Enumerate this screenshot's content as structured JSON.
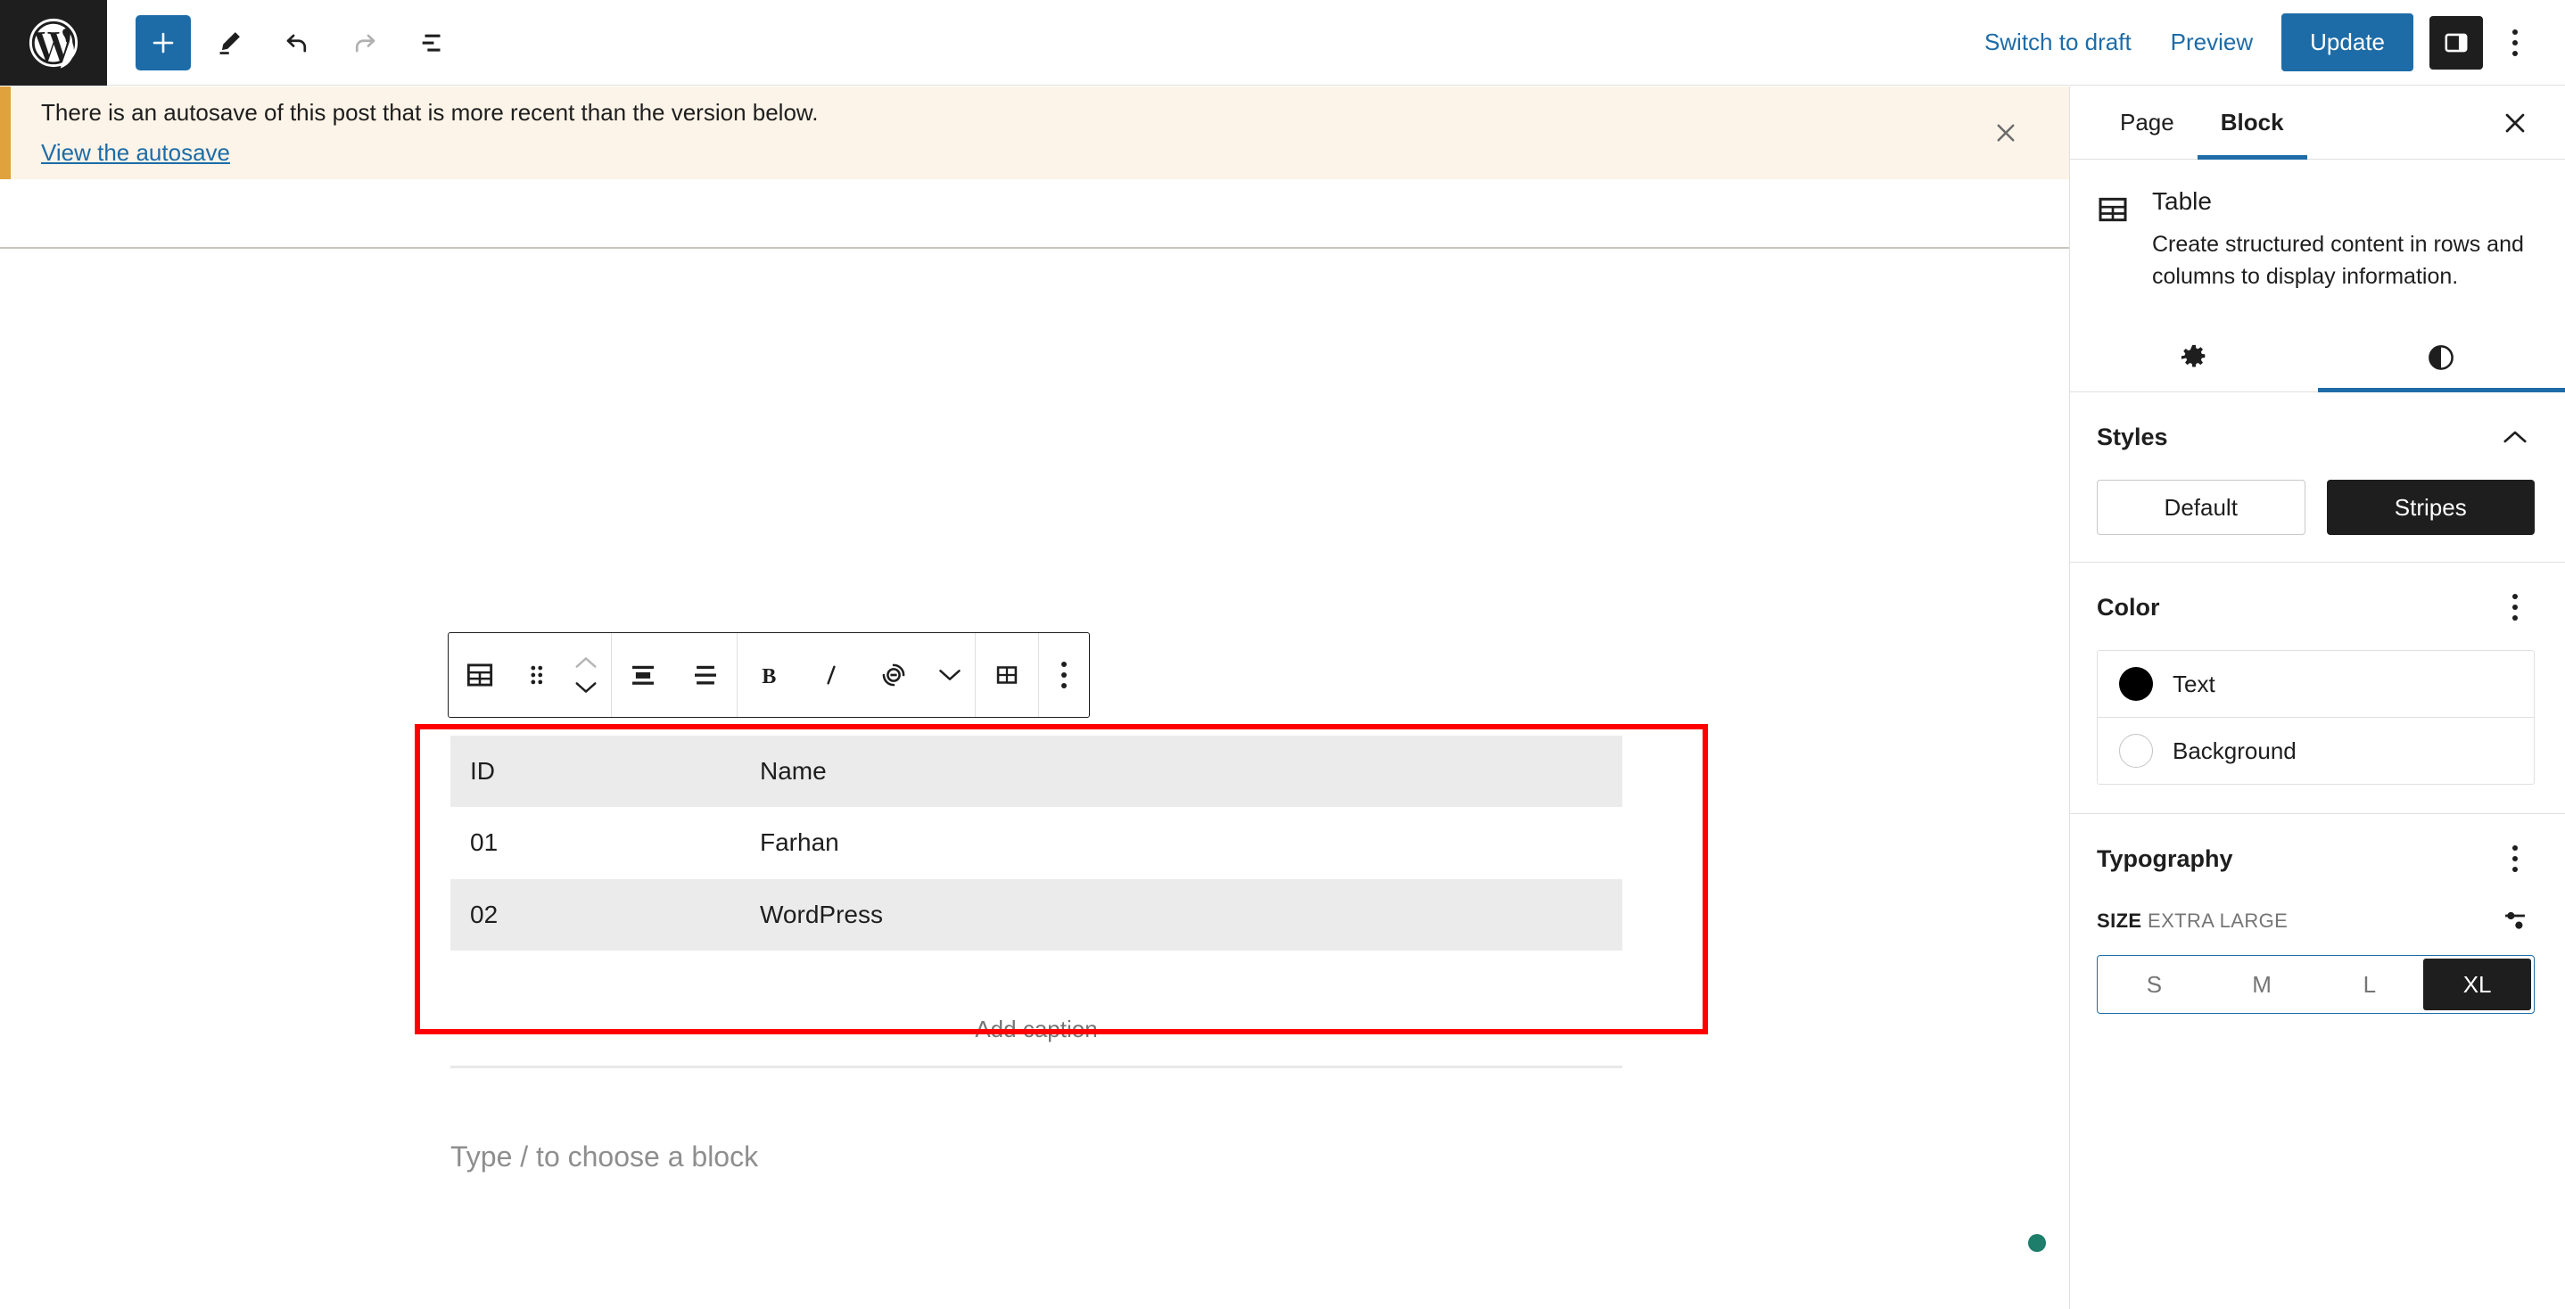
{
  "topbar": {
    "logo_icon": "wordpress-logo-icon",
    "add_block_label": "+",
    "tools": [
      {
        "icon": "pencil-edit-icon",
        "name": "tools-button"
      },
      {
        "icon": "undo-arrow-icon",
        "name": "undo-button"
      },
      {
        "icon": "redo-arrow-icon",
        "name": "redo-button"
      },
      {
        "icon": "list-view-icon",
        "name": "document-overview-button"
      }
    ],
    "switch_to_draft_label": "Switch to draft",
    "preview_label": "Preview",
    "update_label": "Update",
    "sidebar_toggle_icon": "sidebar-panel-icon",
    "options_icon": "kebab-menu-icon"
  },
  "notice": {
    "message": "There is an autosave of this post that is more recent than the version below.",
    "link_label": "View the autosave",
    "close_icon": "close-icon",
    "accent_color": "#e0a23c",
    "background_color": "#fcf4e8"
  },
  "block_toolbar": {
    "items": [
      {
        "name": "block-type-table-button",
        "icon": "table-icon"
      },
      {
        "name": "drag-handle-button",
        "icon": "drag-dots-icon"
      },
      {
        "name": "move-up-down-button",
        "icon": "chevron-up-down-icon"
      },
      {
        "name": "align-button",
        "icon": "align-center-icon"
      },
      {
        "name": "text-align-button",
        "icon": "text-align-icon"
      },
      {
        "name": "bold-button",
        "icon": "bold-icon",
        "label": "B"
      },
      {
        "name": "italic-button",
        "icon": "italic-icon",
        "label": "I"
      },
      {
        "name": "link-button",
        "icon": "link-icon"
      },
      {
        "name": "more-rich-text-button",
        "icon": "chevron-down-icon"
      },
      {
        "name": "edit-table-button",
        "icon": "table-grid-icon"
      },
      {
        "name": "block-options-button",
        "icon": "kebab-menu-icon"
      }
    ]
  },
  "editor": {
    "table": {
      "columns": [
        "ID",
        "Name"
      ],
      "rows": [
        [
          "ID",
          "Name"
        ],
        [
          "01",
          "Farhan"
        ],
        [
          "02",
          "WordPress"
        ]
      ],
      "striped_row_indexes": [
        0,
        2
      ],
      "stripe_color": "#ebebeb"
    },
    "caption_placeholder": "Add caption",
    "empty_paragraph_placeholder": "Type / to choose a block"
  },
  "sidebar": {
    "tabs": [
      {
        "label": "Page",
        "active": false
      },
      {
        "label": "Block",
        "active": true
      }
    ],
    "close_icon": "close-icon",
    "block": {
      "icon": "table-icon",
      "title": "Table",
      "description": "Create structured content in rows and columns to display information."
    },
    "icon_tabs": [
      {
        "name": "settings-tab",
        "icon": "gear-icon",
        "active": false
      },
      {
        "name": "styles-tab",
        "icon": "contrast-half-circle-icon",
        "active": true
      }
    ],
    "styles": {
      "title": "Styles",
      "collapse_icon": "chevron-up-icon",
      "options": [
        {
          "label": "Default",
          "selected": false
        },
        {
          "label": "Stripes",
          "selected": true
        }
      ]
    },
    "color": {
      "title": "Color",
      "menu_icon": "kebab-menu-icon",
      "items": [
        {
          "label": "Text",
          "swatch": "#000000"
        },
        {
          "label": "Background",
          "swatch": "#ffffff"
        }
      ]
    },
    "typography": {
      "title": "Typography",
      "menu_icon": "kebab-menu-icon",
      "size_label": "SIZE",
      "size_value": "EXTRA LARGE",
      "custom_size_icon": "sliders-icon",
      "sizes": [
        {
          "label": "S",
          "selected": false
        },
        {
          "label": "M",
          "selected": false
        },
        {
          "label": "L",
          "selected": false
        },
        {
          "label": "XL",
          "selected": true
        }
      ]
    }
  },
  "annotations": {
    "highlight_color": "#ff0000",
    "boxes": [
      "table-block-highlight",
      "xl-size-highlight"
    ]
  },
  "status_dot_color": "#1c7e6b"
}
